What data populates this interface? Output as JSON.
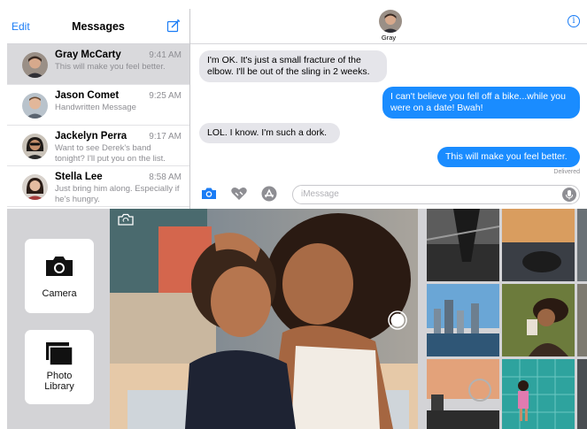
{
  "sidebar": {
    "edit_label": "Edit",
    "title": "Messages",
    "conversations": [
      {
        "name": "Gray McCarty",
        "time": "9:41 AM",
        "preview": "This will make you feel better."
      },
      {
        "name": "Jason Comet",
        "time": "9:25 AM",
        "preview": "Handwritten Message"
      },
      {
        "name": "Jackelyn Perra",
        "time": "9:17 AM",
        "preview": "Want to see Derek's band tonight? I'll put you on the list."
      },
      {
        "name": "Stella Lee",
        "time": "8:58 AM",
        "preview": "Just bring him along. Especially if he's hungry."
      }
    ]
  },
  "conversation": {
    "contact_name": "Gray",
    "info_icon": "i",
    "messages": [
      {
        "direction": "in",
        "text": "I'm OK. It's just a small fracture of the elbow. I'll be out of the sling in 2 weeks."
      },
      {
        "direction": "out",
        "text": "I can't believe you fell off a bike...while you were on a date! Bwah!"
      },
      {
        "direction": "in",
        "text": "LOL. I know. I'm such a dork."
      },
      {
        "direction": "out",
        "text": "This will make you feel better."
      }
    ],
    "delivered_label": "Delivered",
    "input_placeholder": "iMessage"
  },
  "drawer": {
    "camera_label": "Camera",
    "photo_library_label": "Photo Library"
  },
  "colors": {
    "accent": "#1a7cf5",
    "bubble_out": "#1a8cff",
    "bubble_in": "#e5e5ea",
    "drawer_bg": "#d3d3d6"
  },
  "icons": [
    "compose-icon",
    "info-icon",
    "camera-icon",
    "heart-icon",
    "app-store-icon",
    "microphone-icon",
    "flip-camera-icon",
    "shutter-icon",
    "photo-library-icon"
  ]
}
